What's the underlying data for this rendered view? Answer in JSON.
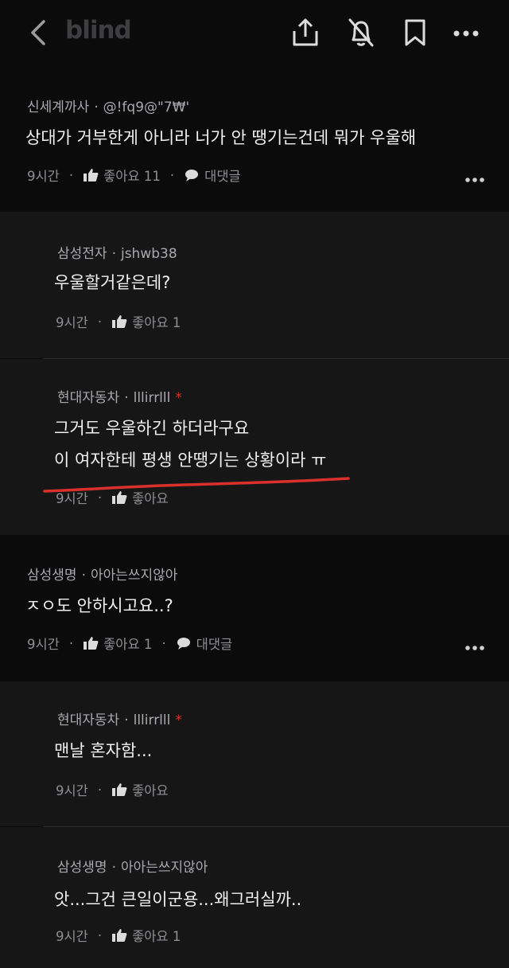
{
  "app": {
    "logo": "blind"
  },
  "comments": [
    {
      "company": "신세계까사",
      "user": "@!fq9@\"7₩'",
      "text": "상대가 거부한게 아니라 너가 안 땡기는건데 뭐가 우울해",
      "time": "9시간",
      "like_label": "좋아요 11",
      "reply_label": "대댓글"
    },
    {
      "company": "삼성전자",
      "user": "jshwb38",
      "text": "우울할거같은데?",
      "time": "9시간",
      "like_label": "좋아요 1"
    },
    {
      "company": "현대자동차",
      "user": "lllirrlll",
      "author_mark": "*",
      "text_line1": "그거도 우울하긴 하더라구요",
      "text_line2": "이 여자한테 평생 안땡기는 상황이라 ㅠ",
      "time": "9시간",
      "like_label": "좋아요"
    },
    {
      "company": "삼성생명",
      "user": "아아는쓰지않아",
      "text": "ㅈㅇ도 안하시고요..?",
      "time": "9시간",
      "like_label": "좋아요 1",
      "reply_label": "대댓글"
    },
    {
      "company": "현대자동차",
      "user": "lllirrlll",
      "author_mark": "*",
      "text": "맨날 혼자함...",
      "time": "9시간",
      "like_label": "좋아요"
    },
    {
      "company": "삼성생명",
      "user": "아아는쓰지않아",
      "text": "앗...그건 큰일이군용...왜그러실까..",
      "time": "9시간",
      "like_label": "좋아요 1"
    }
  ],
  "colors": {
    "background": "#0b0b0c",
    "reply_background": "#161617",
    "annotation": "#d9302b"
  }
}
